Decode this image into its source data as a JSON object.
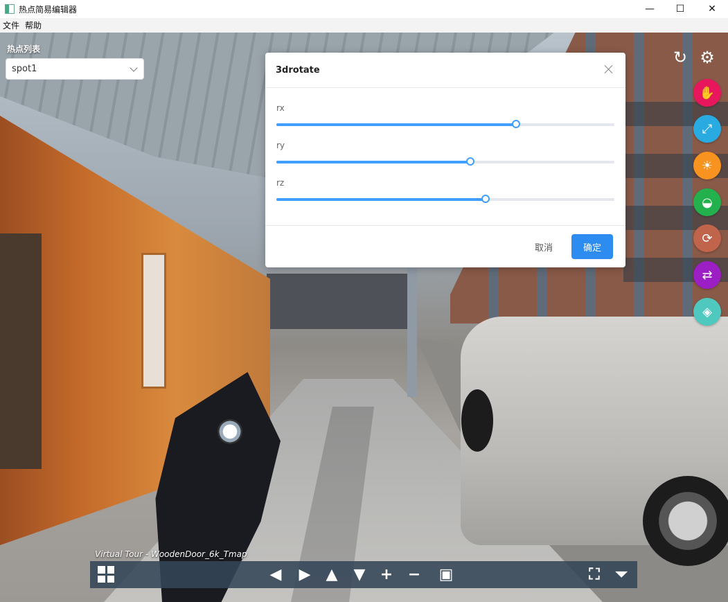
{
  "window": {
    "title": "热点简易编辑器",
    "controls": {
      "minimize": "—",
      "maximize": "☐",
      "close": "✕"
    }
  },
  "menu": {
    "items": [
      "文件",
      "帮助"
    ]
  },
  "hotspot_panel": {
    "label": "热点列表",
    "selected": "spot1"
  },
  "dialog": {
    "title": "3drotate",
    "sliders": [
      {
        "label": "rx",
        "value": 0.71
      },
      {
        "label": "ry",
        "value": 0.573
      },
      {
        "label": "rz",
        "value": 0.619
      }
    ],
    "cancel_label": "取消",
    "ok_label": "确定",
    "accent": "#2d8cf0"
  },
  "top_icons": [
    {
      "name": "refresh-icon",
      "glyph": "↻"
    },
    {
      "name": "gear-icon",
      "glyph": "⚙"
    }
  ],
  "tools": [
    {
      "name": "hand-tool-button",
      "icon": "hand-icon",
      "glyph": "✋",
      "color": "#e8175d"
    },
    {
      "name": "resize-tool-button",
      "icon": "resize-icon",
      "glyph": "⤢",
      "color": "#29abe2"
    },
    {
      "name": "light-tool-button",
      "icon": "lightbulb-icon",
      "glyph": "☀",
      "color": "#f7931e"
    },
    {
      "name": "view-tool-button",
      "icon": "eye-icon",
      "glyph": "◒",
      "color": "#22b14c"
    },
    {
      "name": "rotate-tool-button",
      "icon": "rotate-icon",
      "glyph": "⟳",
      "color": "#c1644c"
    },
    {
      "name": "swap-tool-button",
      "icon": "swap-icon",
      "glyph": "⇄",
      "color": "#9b1fc4"
    },
    {
      "name": "cube-tool-button",
      "icon": "cube-icon",
      "glyph": "◈",
      "color": "#4fc9c0"
    }
  ],
  "tour_caption": "Virtual Tour - WoodenDoor_6k_Tmap",
  "bottombar": {
    "buttons": [
      {
        "name": "thumbnails-button",
        "glyph": ""
      },
      {
        "name": "pan-left-button",
        "glyph": "◀"
      },
      {
        "name": "pan-right-button",
        "glyph": "▶"
      },
      {
        "name": "pan-up-button",
        "glyph": "▲"
      },
      {
        "name": "pan-down-button",
        "glyph": "▼"
      },
      {
        "name": "zoom-in-button",
        "glyph": "+"
      },
      {
        "name": "zoom-out-button",
        "glyph": "−"
      },
      {
        "name": "vr-button",
        "glyph": "▣"
      },
      {
        "name": "fullscreen-button",
        "glyph": "⛶"
      },
      {
        "name": "hide-bar-button",
        "glyph": "⏷"
      }
    ]
  }
}
